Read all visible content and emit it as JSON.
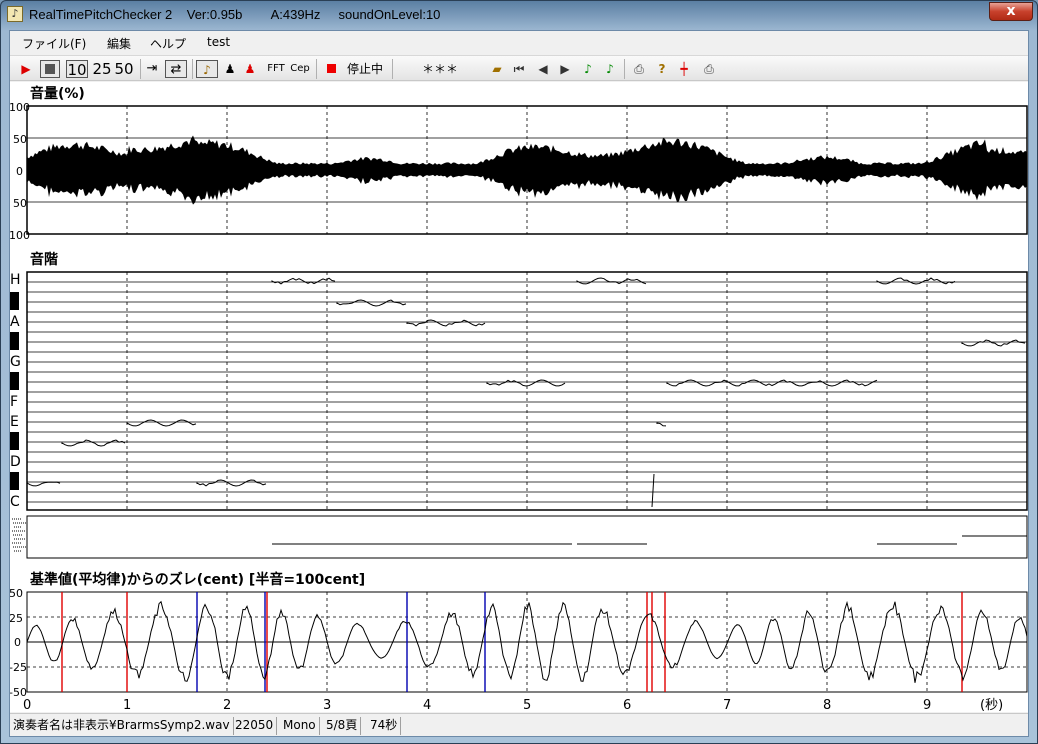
{
  "window": {
    "title": "RealTimePitchChecker 2    Ver:0.95b        A:439Hz     soundOnLevel:10",
    "close_glyph": "x"
  },
  "menu": [
    "ファイル(F)",
    "編集",
    "ヘルプ",
    "test"
  ],
  "toolbar": {
    "speed_options": [
      "10",
      "25",
      "50"
    ],
    "fft_label": "FFT",
    "cep_label": "Cep",
    "status_text": "停止中",
    "note_display": "＊＊＊"
  },
  "volume_panel": {
    "title": "音量(%)",
    "y_ticks": [
      "100",
      "50",
      "0",
      "50",
      "100"
    ]
  },
  "scale_panel": {
    "title": "音階",
    "notes": [
      "H",
      "A",
      "G",
      "F",
      "E",
      "D",
      "C"
    ]
  },
  "deviation_panel": {
    "title": "基準値(平均律)からのズレ(cent) [半音=100cent]",
    "y_ticks": [
      "50",
      "25",
      "0",
      "-25",
      "-50"
    ],
    "x_ticks": [
      "0",
      "1",
      "2",
      "3",
      "4",
      "5",
      "6",
      "7",
      "8",
      "9"
    ],
    "x_unit": "(秒)"
  },
  "status": {
    "file": "演奏者名は非表示¥BrarmsSymp2.wav",
    "rate": "22050",
    "channels": "Mono",
    "page": "5/8頁",
    "length": "74秒"
  },
  "chart_data": {
    "type": "line",
    "x_range": [
      0,
      10
    ],
    "grid": true,
    "pitch_segments": [
      {
        "t0": 0.0,
        "t1": 0.35,
        "note": "C#"
      },
      {
        "t0": 0.35,
        "t1": 1.0,
        "note": "D#"
      },
      {
        "t0": 1.0,
        "t1": 1.7,
        "note": "E"
      },
      {
        "t0": 1.7,
        "t1": 2.4,
        "note": "C#"
      },
      {
        "t0": 2.45,
        "t1": 3.1,
        "note": "H"
      },
      {
        "t0": 3.1,
        "t1": 3.8,
        "note": "A#"
      },
      {
        "t0": 3.8,
        "t1": 4.6,
        "note": "A"
      },
      {
        "t0": 4.6,
        "t1": 5.4,
        "note": "F#"
      },
      {
        "t0": 5.5,
        "t1": 6.2,
        "note": "H"
      },
      {
        "t0": 6.3,
        "t1": 6.4,
        "note": "E"
      },
      {
        "t0": 6.4,
        "t1": 8.5,
        "note": "F#"
      },
      {
        "t0": 8.5,
        "t1": 9.3,
        "note": "H"
      },
      {
        "t0": 9.35,
        "t1": 10.0,
        "note": "G#"
      }
    ],
    "colors": {
      "red_marker": "#e00000",
      "blue_marker": "#0000b0",
      "signal": "#000000"
    }
  }
}
